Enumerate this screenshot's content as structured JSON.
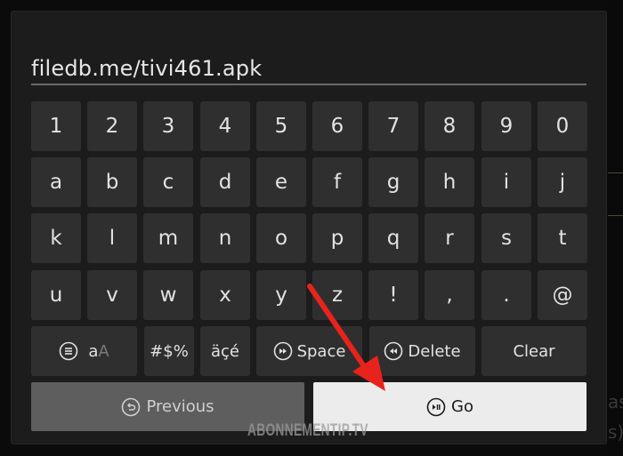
{
  "input": {
    "value": "filedb.me/tivi461.apk"
  },
  "keyboard": {
    "rows": [
      [
        "1",
        "2",
        "3",
        "4",
        "5",
        "6",
        "7",
        "8",
        "9",
        "0"
      ],
      [
        "a",
        "b",
        "c",
        "d",
        "e",
        "f",
        "g",
        "h",
        "i",
        "j"
      ],
      [
        "k",
        "l",
        "m",
        "n",
        "o",
        "p",
        "q",
        "r",
        "s",
        "t"
      ],
      [
        "u",
        "v",
        "w",
        "x",
        "y",
        "z",
        "!",
        ",",
        ".",
        "@"
      ]
    ],
    "function_keys": {
      "case_lower": "a",
      "case_upper": "A",
      "symbols": "#$%",
      "accents": "äçé",
      "space": "Space",
      "delete": "Delete",
      "clear": "Clear"
    }
  },
  "actions": {
    "previous": "Previous",
    "go": "Go"
  },
  "watermark": "ABONNEMENTIP.TV",
  "background_partial_text": [
    "as",
    "s)"
  ],
  "colors": {
    "panel": "#1c1c1c",
    "key": "#2f2f2f",
    "go_button": "#ececec",
    "previous_button": "#5e5e5e",
    "annotation_arrow": "#e8231c"
  }
}
